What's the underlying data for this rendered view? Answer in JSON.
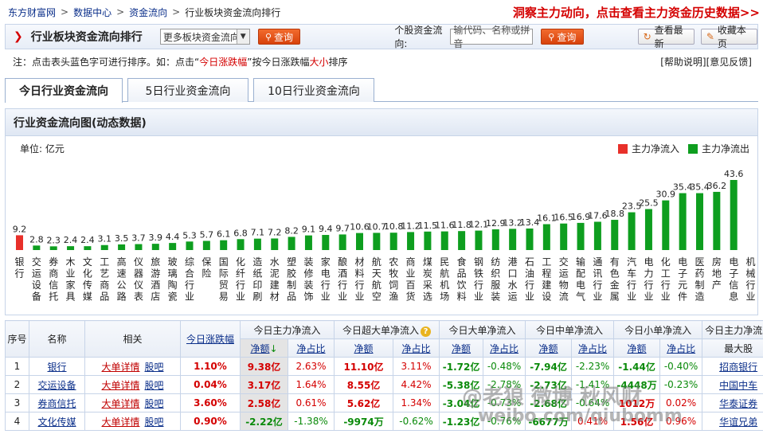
{
  "breadcrumb": [
    "东方财富网",
    "数据中心",
    "资金流向",
    "行业板块资金流向排行"
  ],
  "promo": "洞察主力动向，点击查看主力资金历史数据>>",
  "titlebar": {
    "title": "行业板块资金流向排行",
    "select_value": "更多板块资金流向",
    "query_label": "查询",
    "stock_label": "个股资金流向:",
    "stock_placeholder": "输代码、名称或拼音",
    "query2_label": "查询",
    "refresh_label": "查看最新",
    "bookmark_label": "收藏本页"
  },
  "note": {
    "prefix": "注：点击表头蓝色字可进行排序。如：点击“",
    "red1": "今日涨跌幅",
    "mid": "”按今日涨跌幅",
    "red2": "大小",
    "suffix": "排序",
    "help": "[帮助说明]",
    "feedback": "[意见反馈]"
  },
  "tabs": [
    "今日行业资金流向",
    "5日行业资金流向",
    "10日行业资金流向"
  ],
  "chart_panel": {
    "title": "行业资金流向图(动态数据)",
    "unit": "单位: 亿元",
    "legend_in": "主力净流入",
    "legend_out": "主力净流出",
    "color_in": "#e8302a",
    "color_out": "#0e9e1f"
  },
  "chart_data": {
    "type": "bar",
    "categories": [
      "银行",
      "交运设备",
      "券商信托",
      "木业家具",
      "文化传媒",
      "工艺商品",
      "高速公路",
      "仪器仪表",
      "旅游酒店",
      "玻璃陶瓷",
      "综合行业",
      "保险",
      "国际贸易",
      "化纤行业",
      "造纸印刷",
      "水泥建材",
      "塑胶制品",
      "装修装饰",
      "家电行业",
      "酿酒行业",
      "材料行业",
      "航天航空",
      "农牧饲渔",
      "商业百货",
      "煤炭采选",
      "民航机场",
      "食品饮料",
      "钢铁行业",
      "纺织服装",
      "港口水运",
      "石油行业",
      "工程建设",
      "交运物流",
      "输配电气",
      "通讯行业",
      "有色金属",
      "汽车行业",
      "电力行业",
      "化工行业",
      "电子元件",
      "医药制造",
      "房地产",
      "电子信息",
      "机械行业"
    ],
    "values": [
      9.2,
      2.8,
      2.3,
      2.4,
      2.4,
      3.1,
      3.5,
      3.7,
      3.9,
      4.4,
      5.3,
      5.7,
      6.1,
      6.8,
      7.1,
      7.2,
      8.2,
      9.1,
      9.4,
      9.7,
      10.6,
      10.7,
      10.8,
      11.2,
      11.5,
      11.6,
      11.8,
      12.1,
      12.9,
      13.2,
      13.4,
      16.1,
      16.5,
      16.9,
      17.6,
      18.8,
      23.5,
      25.5,
      30.9,
      35.4,
      35.4,
      36.2,
      43.6
    ],
    "value_labels": [
      "9.2",
      "2.8",
      "2.3",
      "2.4",
      "2.4",
      "3.1",
      "3.5",
      "3.7",
      "3.9",
      "4.4",
      "5.3",
      "5.7",
      "6.1",
      "6.8",
      "7.1",
      "7.2",
      "8.2",
      "9.1",
      "9.4",
      "9.7",
      "10.6",
      "10.7",
      "10.8",
      "11.2",
      "11.5",
      "11.6",
      "11.8",
      "12.1",
      "12.9",
      "13.2",
      "13.4",
      "16.1",
      "16.5",
      "16.9",
      "17.6",
      "18.8",
      "23.5",
      "25.5",
      "30.9",
      "35.4",
      "35.4",
      "36.2",
      "43.6"
    ],
    "direction": [
      "in",
      "out",
      "out",
      "out",
      "out",
      "out",
      "out",
      "out",
      "out",
      "out",
      "out",
      "out",
      "out",
      "out",
      "out",
      "out",
      "out",
      "out",
      "out",
      "out",
      "out",
      "out",
      "out",
      "out",
      "out",
      "out",
      "out",
      "out",
      "out",
      "out",
      "out",
      "out",
      "out",
      "out",
      "out",
      "out",
      "out",
      "out",
      "out",
      "out",
      "out",
      "out",
      "out",
      "out"
    ]
  },
  "table": {
    "headers": {
      "seq": "序号",
      "name": "名称",
      "related": "相关",
      "change": "今日涨跌幅",
      "main": "今日主力净流入",
      "super": "今日超大单净流入",
      "large": "今日大单净流入",
      "medium": "今日中单净流入",
      "small": "今日小单净流入",
      "maxstock": "今日主力净流入",
      "amount": "净额",
      "ratio": "净占比",
      "maxstock2": "最大股"
    },
    "rows": [
      {
        "seq": "1",
        "name": "银行",
        "detail": "大单详情",
        "bar": "股吧",
        "change": "1.10%",
        "main_amt": "9.38亿",
        "main_ratio": "2.63%",
        "super_amt": "11.10亿",
        "super_ratio": "3.11%",
        "large_amt": "-1.72亿",
        "large_ratio": "-0.48%",
        "mid_amt": "-7.94亿",
        "mid_ratio": "-2.23%",
        "small_amt": "-1.44亿",
        "small_ratio": "-0.40%",
        "top": "招商银行"
      },
      {
        "seq": "2",
        "name": "交运设备",
        "detail": "大单详情",
        "bar": "股吧",
        "change": "0.04%",
        "main_amt": "3.17亿",
        "main_ratio": "1.64%",
        "super_amt": "8.55亿",
        "super_ratio": "4.42%",
        "large_amt": "-5.38亿",
        "large_ratio": "-2.78%",
        "mid_amt": "-2.73亿",
        "mid_ratio": "-1.41%",
        "small_amt": "-4448万",
        "small_ratio": "-0.23%",
        "top": "中国中车"
      },
      {
        "seq": "3",
        "name": "券商信托",
        "detail": "大单详情",
        "bar": "股吧",
        "change": "3.60%",
        "main_amt": "2.58亿",
        "main_ratio": "0.61%",
        "super_amt": "5.62亿",
        "super_ratio": "1.34%",
        "large_amt": "-3.04亿",
        "large_ratio": "-0.73%",
        "mid_amt": "-2.68亿",
        "mid_ratio": "-0.64%",
        "small_amt": "1012万",
        "small_ratio": "0.02%",
        "top": "华泰证券"
      },
      {
        "seq": "4",
        "name": "文化传媒",
        "detail": "大单详情",
        "bar": "股吧",
        "change": "0.90%",
        "main_amt": "-2.22亿",
        "main_ratio": "-1.38%",
        "super_amt": "-9974万",
        "super_ratio": "-0.62%",
        "large_amt": "-1.23亿",
        "large_ratio": "-0.76%",
        "mid_amt": "-6677万",
        "mid_ratio": "0.41%",
        "small_amt": "1.56亿",
        "small_ratio": "0.96%",
        "top": "华谊兄弟"
      }
    ]
  },
  "watermark": {
    "line1": "@老狼 微博 秋风财",
    "line2": "weibo.com/qiubomm"
  }
}
